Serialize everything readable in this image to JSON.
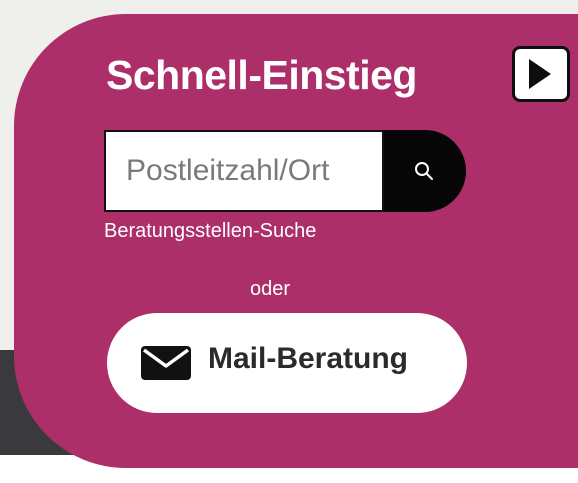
{
  "quick_entry": {
    "title": "Schnell-Einstieg",
    "toggle_icon": "play-triangle-icon",
    "search": {
      "placeholder": "Postleitzahl/Ort",
      "value": "",
      "button_icon": "search-icon",
      "caption": "Beratungsstellen-Suche"
    },
    "separator": "oder",
    "mail_button": {
      "icon": "envelope-icon",
      "label": "Mail-Beratung"
    }
  },
  "colors": {
    "panel": "#ad2f6a",
    "search_button": "#060606",
    "text_light": "#ffffff",
    "text_dark": "#2b2b2b"
  }
}
